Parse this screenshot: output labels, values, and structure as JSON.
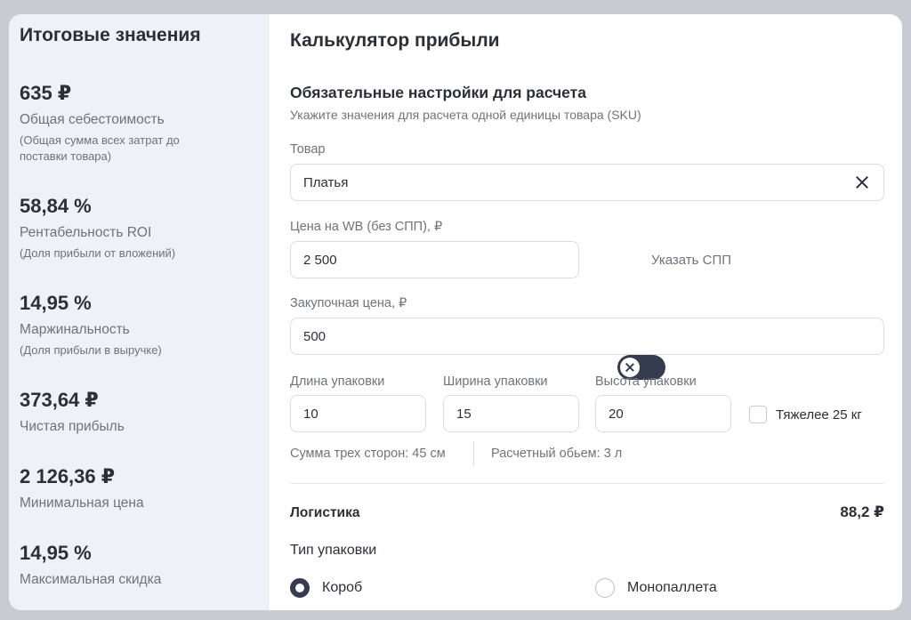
{
  "summary": {
    "title": "Итоговые значения",
    "metrics": [
      {
        "value": "635 ₽",
        "label": "Общая себестоимость",
        "sub": "(Общая сумма всех затрат до поставки товара)"
      },
      {
        "value": "58,84 %",
        "label": "Рентабельность ROI",
        "sub": "(Доля прибыли от вложений)"
      },
      {
        "value": "14,95 %",
        "label": "Маржинальность",
        "sub": "(Доля прибыли в выручке)"
      },
      {
        "value": "373,64 ₽",
        "label": "Чистая прибыль"
      },
      {
        "value": "2 126,36 ₽",
        "label": "Минимальная цена"
      },
      {
        "value": "14,95 %",
        "label": "Максимальная скидка"
      }
    ]
  },
  "calc": {
    "title": "Калькулятор прибыли",
    "section_title": "Обязательные настройки для расчета",
    "section_sub": "Укажите значения для расчета одной единицы товара (SKU)",
    "product": {
      "label": "Товар",
      "value": "Платья"
    },
    "price": {
      "label": "Цена на WB (без СПП), ₽",
      "value": "2 500"
    },
    "spp_toggle_label": "Указать СПП",
    "purchase": {
      "label": "Закупочная цена, ₽",
      "value": "500"
    },
    "length": {
      "label": "Длина упаковки",
      "value": "10"
    },
    "width": {
      "label": "Ширина упаковки",
      "value": "15"
    },
    "height": {
      "label": "Высота упаковки",
      "value": "20"
    },
    "heavy_label": "Тяжелее 25 кг",
    "sum_sides": "Сумма трех сторон: 45 см",
    "volume": "Расчетный обьем: 3 л",
    "logistics": {
      "label": "Логистика",
      "value": "88,2 ₽"
    },
    "pack_type_label": "Тип упаковки",
    "pack_options": [
      "Короб",
      "Монопаллета"
    ]
  }
}
